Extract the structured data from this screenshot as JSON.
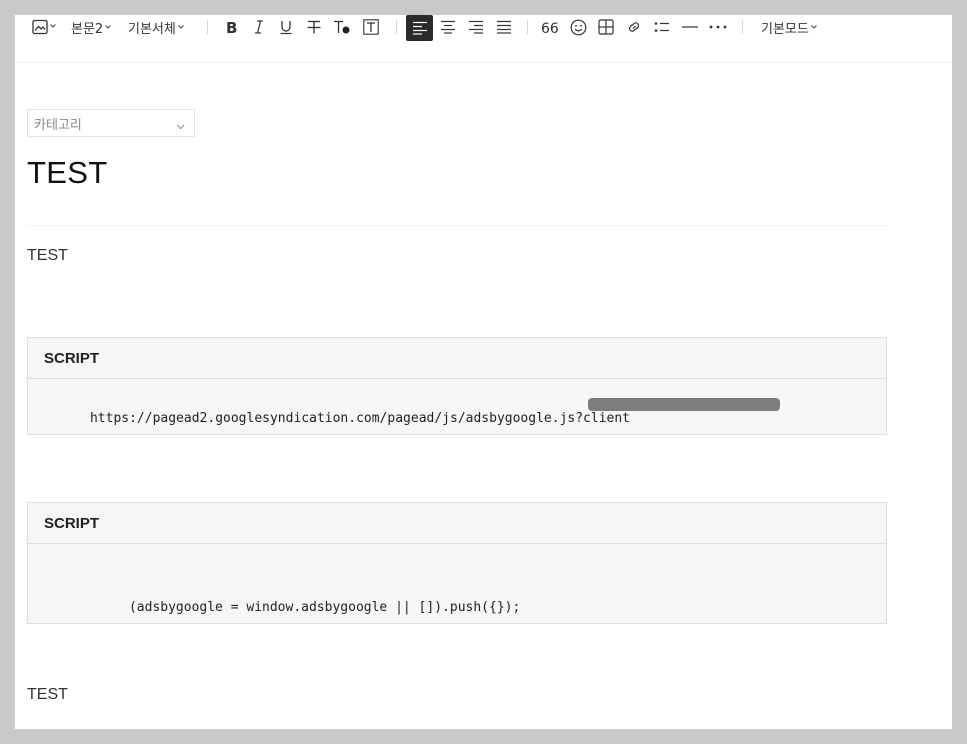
{
  "toolbar": {
    "paragraph_style": "본문2",
    "font_family": "기본서체",
    "mode": "기본모드",
    "icons": [
      "image-icon",
      "bold-icon",
      "italic-icon",
      "underline-icon",
      "strikethrough-icon",
      "text-color-icon",
      "text-background-icon",
      "align-left-icon",
      "align-center-icon",
      "align-right-icon",
      "align-justify-icon",
      "quote-icon",
      "emoji-icon",
      "table-icon",
      "link-icon",
      "list-icon",
      "divider-icon",
      "more-icon"
    ]
  },
  "editor": {
    "category_placeholder": "카테고리",
    "title": "TEST",
    "paragraph1": "TEST",
    "code_block1": {
      "header": "SCRIPT",
      "code": "https://pagead2.googlesyndication.com/pagead/js/adsbygoogle.js?client"
    },
    "code_block2": {
      "header": "SCRIPT",
      "code": "(adsbygoogle = window.adsbygoogle || []).push({});"
    },
    "paragraph2": "TEST"
  },
  "colors": {
    "page_background": "#c9c9c9",
    "editor_background": "#ffffff",
    "code_background": "#f5f6f8",
    "active_button": "#2b2b2b"
  }
}
